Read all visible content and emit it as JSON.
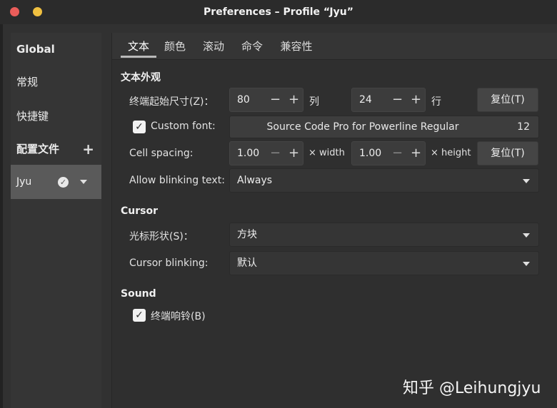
{
  "window": {
    "title": "Preferences – Profile “Jyu”"
  },
  "sidebar": {
    "global": "Global",
    "general": "常规",
    "shortcuts": "快捷键",
    "profiles_header": "配置文件",
    "add_symbol": "+",
    "profile_name": "Jyu",
    "check_symbol": "✓"
  },
  "tabs": [
    "文本",
    "颜色",
    "滚动",
    "命令",
    "兼容性"
  ],
  "text_section": {
    "heading": "文本外观",
    "size_label": "终端起始尺寸(Z)：",
    "columns_value": "80",
    "columns_unit": "列",
    "rows_value": "24",
    "rows_unit": "行",
    "reset_label": "复位(T)",
    "minus": "−",
    "plus": "+",
    "custom_font_label": "Custom font:",
    "font_name": "Source Code Pro for Powerline Regular",
    "font_size": "12",
    "cell_spacing_label": "Cell spacing:",
    "width_value": "1.00",
    "width_unit": "× width",
    "height_value": "1.00",
    "height_unit": "× height",
    "blink_label": "Allow blinking text:",
    "blink_value": "Always"
  },
  "cursor_section": {
    "heading": "Cursor",
    "shape_label": "光标形状(S)：",
    "shape_value": "方块",
    "blinking_label": "Cursor blinking:",
    "blinking_value": "默认"
  },
  "sound_section": {
    "heading": "Sound",
    "bell_label": "终端响铃(B)"
  },
  "checkbox_mark": "✓",
  "watermark": "知乎 @Leihungjyu"
}
